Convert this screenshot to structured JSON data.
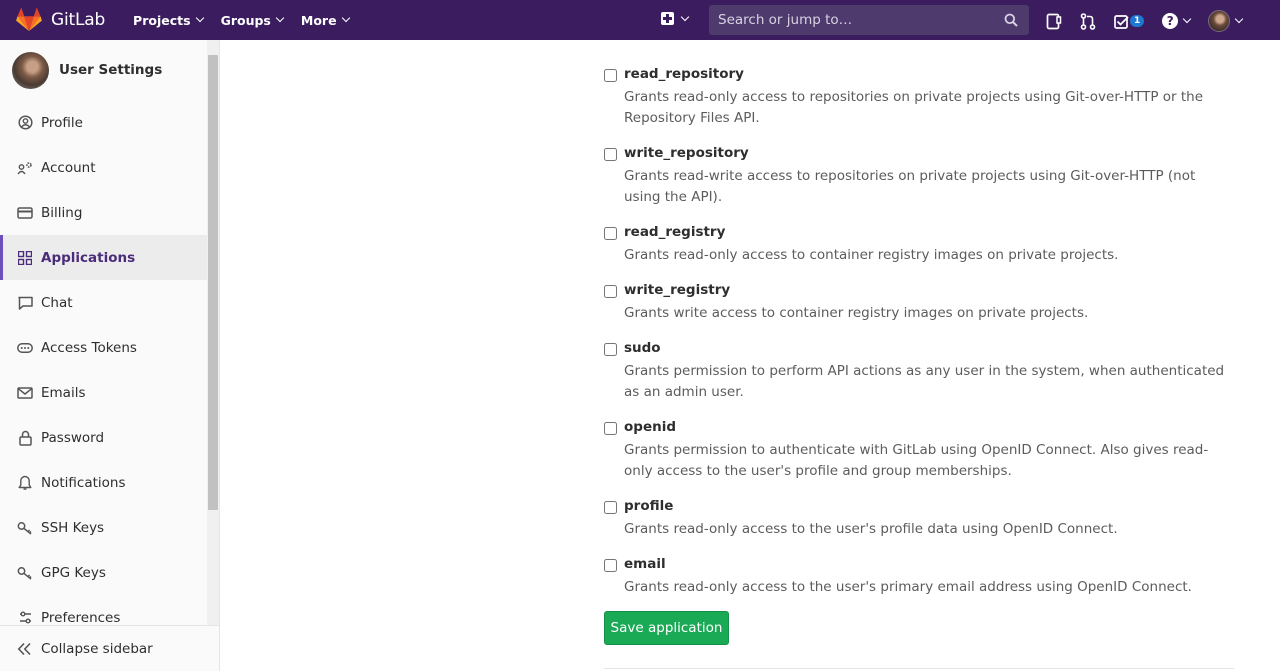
{
  "navbar": {
    "brand": "GitLab",
    "menu": [
      {
        "label": "Projects"
      },
      {
        "label": "Groups"
      },
      {
        "label": "More"
      }
    ],
    "search_placeholder": "Search or jump to…",
    "todo_count": "1",
    "colors": {
      "navbar_bg": "#3b1d5f",
      "search_bg": "#4f3a6e",
      "badge": "#1f78d1"
    }
  },
  "sidebar": {
    "title": "User Settings",
    "items": [
      {
        "label": "Profile",
        "icon": "profile-icon"
      },
      {
        "label": "Account",
        "icon": "account-icon"
      },
      {
        "label": "Billing",
        "icon": "credit-card-icon"
      },
      {
        "label": "Applications",
        "icon": "applications-grid-icon",
        "active": true
      },
      {
        "label": "Chat",
        "icon": "comment-icon"
      },
      {
        "label": "Access Tokens",
        "icon": "token-icon"
      },
      {
        "label": "Emails",
        "icon": "envelope-icon"
      },
      {
        "label": "Password",
        "icon": "lock-icon"
      },
      {
        "label": "Notifications",
        "icon": "bell-icon"
      },
      {
        "label": "SSH Keys",
        "icon": "key-icon"
      },
      {
        "label": "GPG Keys",
        "icon": "key-icon"
      },
      {
        "label": "Preferences",
        "icon": "preferences-icon"
      }
    ],
    "collapse_label": "Collapse sidebar",
    "colors": {
      "active_text": "#4b2c7a",
      "active_bar": "#6b4fbb"
    }
  },
  "scopes": [
    {
      "name": "read_repository",
      "description": "Grants read-only access to repositories on private projects using Git-over-HTTP or the Repository Files API.",
      "checked": false
    },
    {
      "name": "write_repository",
      "description": "Grants read-write access to repositories on private projects using Git-over-HTTP (not using the API).",
      "checked": false
    },
    {
      "name": "read_registry",
      "description": "Grants read-only access to container registry images on private projects.",
      "checked": false
    },
    {
      "name": "write_registry",
      "description": "Grants write access to container registry images on private projects.",
      "checked": false
    },
    {
      "name": "sudo",
      "description": "Grants permission to perform API actions as any user in the system, when authenticated as an admin user.",
      "checked": false
    },
    {
      "name": "openid",
      "description": "Grants permission to authenticate with GitLab using OpenID Connect. Also gives read-only access to the user's profile and group memberships.",
      "checked": false
    },
    {
      "name": "profile",
      "description": "Grants read-only access to the user's profile data using OpenID Connect.",
      "checked": false
    },
    {
      "name": "email",
      "description": "Grants read-only access to the user's primary email address using OpenID Connect.",
      "checked": false
    }
  ],
  "save_button": {
    "label": "Save application",
    "color": "#1aaa55"
  }
}
